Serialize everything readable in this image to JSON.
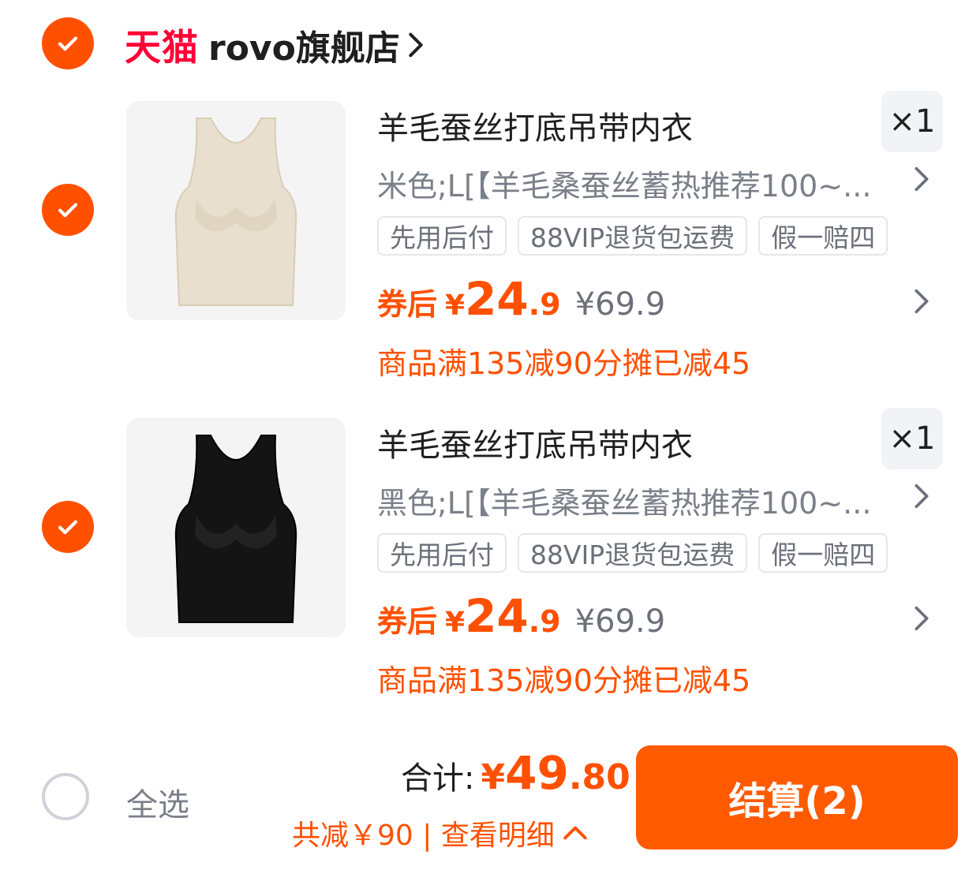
{
  "store": {
    "logo_text": "天猫",
    "name": "rovo旗舰店"
  },
  "items": [
    {
      "title": "羊毛蚕丝打底吊带内衣",
      "quantity": "×1",
      "sku": "米色;L[【羊毛桑蚕丝蓄热推荐100~...",
      "tags": [
        "先用后付",
        "88VIP退货包运费",
        "假一赔四"
      ],
      "coupon_label": "券后",
      "currency": "¥",
      "price_int": "24",
      "price_dec": ".9",
      "original_price": "¥69.9",
      "promo": "商品满135减90分摊已减45",
      "color": "#e8dfcf",
      "checked": true
    },
    {
      "title": "羊毛蚕丝打底吊带内衣",
      "quantity": "×1",
      "sku": "黑色;L[【羊毛桑蚕丝蓄热推荐100~...",
      "tags": [
        "先用后付",
        "88VIP退货包运费",
        "假一赔四"
      ],
      "coupon_label": "券后",
      "currency": "¥",
      "price_int": "24",
      "price_dec": ".9",
      "original_price": "¥69.9",
      "promo": "商品满135减90分摊已减45",
      "color": "#141414",
      "checked": true
    }
  ],
  "footer": {
    "select_all": "全选",
    "total_label": "合计:",
    "total_currency": "¥",
    "total_int": "49",
    "total_dec": ".80",
    "saving_text": "共减￥90 | 查看明细",
    "checkout_label": "结算(2)"
  },
  "colors": {
    "accent": "#ff5000",
    "tmall_red": "#ff0036",
    "button": "#ff5a00"
  },
  "icons": {
    "check": "check-icon",
    "chevron_right": "chevron-right-icon",
    "chevron_up": "chevron-up-icon"
  }
}
